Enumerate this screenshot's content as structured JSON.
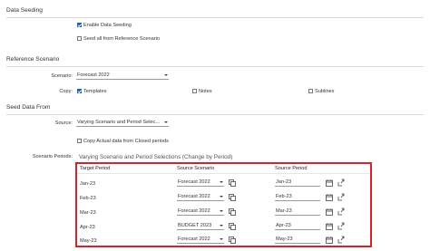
{
  "data_seeding": {
    "title": "Data Seeding",
    "enable_label": "Enable Data Seeding",
    "enable_checked": true,
    "seed_all_label": "Seed all from Reference Scenario",
    "seed_all_checked": false
  },
  "reference_scenario": {
    "title": "Reference Scenario",
    "scenario_label": "Scenario:",
    "scenario_value": "Forecast 2022",
    "copy_label": "Copy:",
    "copy_options": [
      {
        "label": "Templates",
        "checked": true
      },
      {
        "label": "Notes",
        "checked": false
      },
      {
        "label": "Sublines",
        "checked": false
      }
    ]
  },
  "seed_data_from": {
    "title": "Seed Data From",
    "source_label": "Source:",
    "source_value": "Varying Scenario and Period Selec...",
    "copy_actual_label": "Copy Actual data from Closed periods",
    "copy_actual_checked": false
  },
  "scenario_periods": {
    "label": "Scenario Periods:",
    "title": "Varying Scenario and Period Selections (Change by Period)",
    "columns": {
      "target": "Target Period",
      "source_scenario": "Source Scenario",
      "source_period": "Source Period"
    },
    "rows": [
      {
        "target": "Jan-23",
        "scenario": "Forecast 2022",
        "period": "Jan-23"
      },
      {
        "target": "Feb-23",
        "scenario": "Forecast 2022",
        "period": "Feb-23"
      },
      {
        "target": "Mar-23",
        "scenario": "Forecast 2022",
        "period": "Mar-23"
      },
      {
        "target": "Apr-23",
        "scenario": "BUDGET 2023",
        "period": "Apr-23"
      },
      {
        "target": "May-23",
        "scenario": "Forecast 2022",
        "period": "May-23"
      }
    ]
  },
  "colors": {
    "accent": "#1f5fbf",
    "highlight_border": "#d8232a"
  },
  "icons": [
    "copy-icon",
    "calendar-icon",
    "export-icon",
    "chevron-down-icon",
    "checkbox-icon"
  ]
}
